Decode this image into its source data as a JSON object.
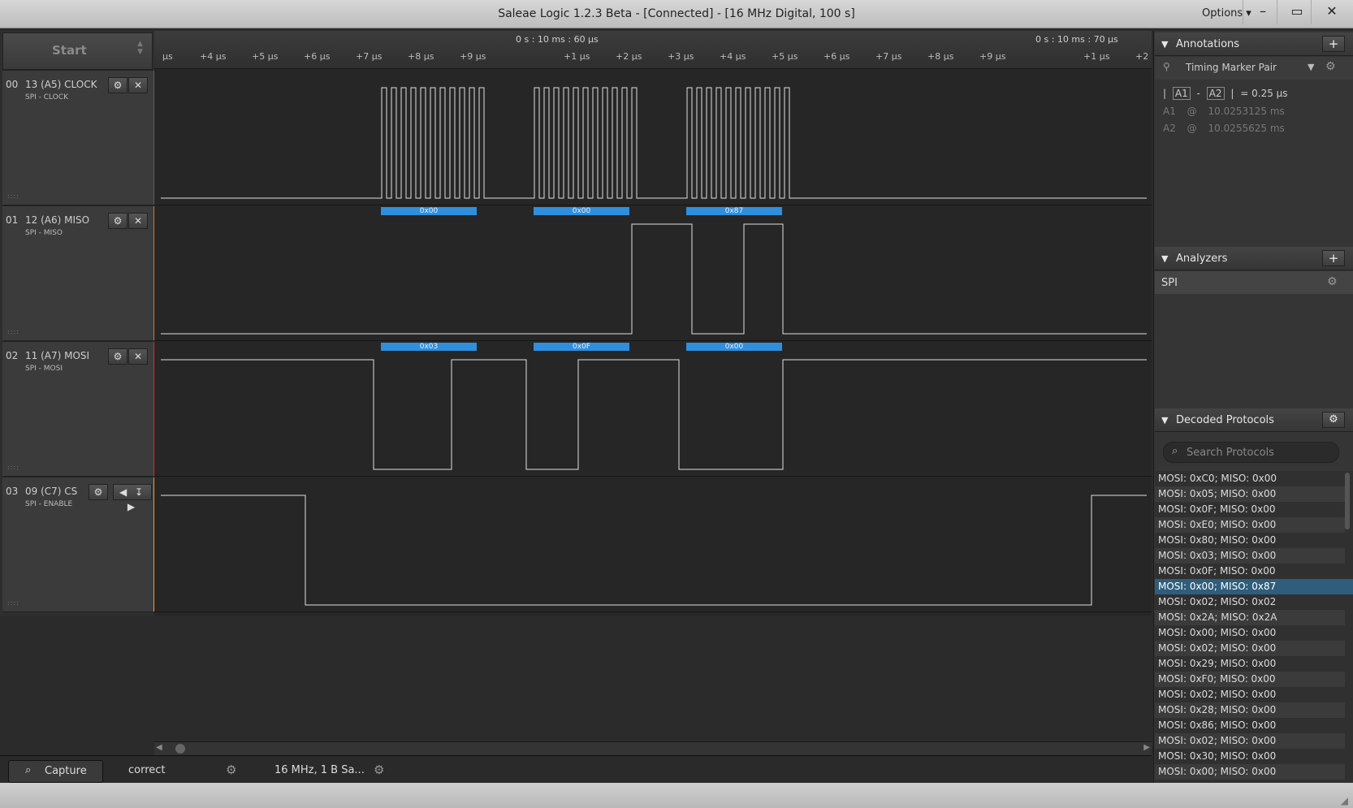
{
  "window": {
    "title": "Saleae Logic 1.2.3 Beta - [Connected] - [16 MHz Digital, 100 s]",
    "options_label": "Options ▾",
    "minimize": "–",
    "maximize": "▭",
    "close": "✕"
  },
  "start_button": "Start",
  "ruler": {
    "time_left": "0 s : 10 ms : 60 µs",
    "time_right": "0 s : 10 ms : 70 µs",
    "ticks": [
      "µs",
      "+4 µs",
      "+5 µs",
      "+6 µs",
      "+7 µs",
      "+8 µs",
      "+9 µs",
      "+1 µs",
      "+2 µs",
      "+3 µs",
      "+4 µs",
      "+5 µs",
      "+6 µs",
      "+7 µs",
      "+8 µs",
      "+9 µs",
      "+1 µs",
      "+2"
    ]
  },
  "channels": [
    {
      "num": "00",
      "name": "13 (A5) CLOCK",
      "sub": "SPI - CLOCK",
      "color": "#5b5b5b"
    },
    {
      "num": "01",
      "name": "12 (A6) MISO",
      "sub": "SPI - MISO",
      "color": "#d67a28"
    },
    {
      "num": "02",
      "name": "11 (A7) MOSI",
      "sub": "SPI - MOSI",
      "color": "#d82c2c"
    },
    {
      "num": "03",
      "name": "09 (C7) CS",
      "sub": "SPI - ENABLE",
      "color": "#e8a020"
    }
  ],
  "miso_bytes": [
    "0x00",
    "0x00",
    "0x87"
  ],
  "mosi_bytes": [
    "0x03",
    "0x0F",
    "0x00"
  ],
  "annotations": {
    "header": "Annotations",
    "marker_pair": "Timing Marker Pair",
    "delta_prefix": "|",
    "a1_tag": "A1",
    "a2_tag": "A2",
    "delta_value": "= 0.25 µs",
    "a1_label": "A1",
    "a1_value": "10.0253125 ms",
    "a2_label": "A2",
    "a2_value": "10.0255625 ms"
  },
  "analyzers": {
    "header": "Analyzers",
    "items": [
      "SPI"
    ]
  },
  "decoded": {
    "header": "Decoded Protocols",
    "search_placeholder": "Search Protocols",
    "rows": [
      "MOSI: 0xC0;  MISO: 0x00",
      "MOSI: 0x05;  MISO: 0x00",
      "MOSI: 0x0F;  MISO: 0x00",
      "MOSI: 0xE0;  MISO: 0x00",
      "MOSI: 0x80;  MISO: 0x00",
      "MOSI: 0x03;  MISO: 0x00",
      "MOSI: 0x0F;  MISO: 0x00",
      "MOSI: 0x00;  MISO: 0x87",
      "MOSI: 0x02;  MISO: 0x02",
      "MOSI: 0x2A;  MISO: 0x2A",
      "MOSI: 0x00;  MISO: 0x00",
      "MOSI: 0x02;  MISO: 0x00",
      "MOSI: 0x29;  MISO: 0x00",
      "MOSI: 0xF0;  MISO: 0x00",
      "MOSI: 0x02;  MISO: 0x00",
      "MOSI: 0x28;  MISO: 0x00",
      "MOSI: 0x86;  MISO: 0x00",
      "MOSI: 0x02;  MISO: 0x00",
      "MOSI: 0x30;  MISO: 0x00",
      "MOSI: 0x00;  MISO: 0x00"
    ],
    "selected_index": 7
  },
  "bottom_tabs": {
    "capture": "Capture",
    "session": "correct",
    "rate": "16 MHz, 1 B Sa..."
  }
}
